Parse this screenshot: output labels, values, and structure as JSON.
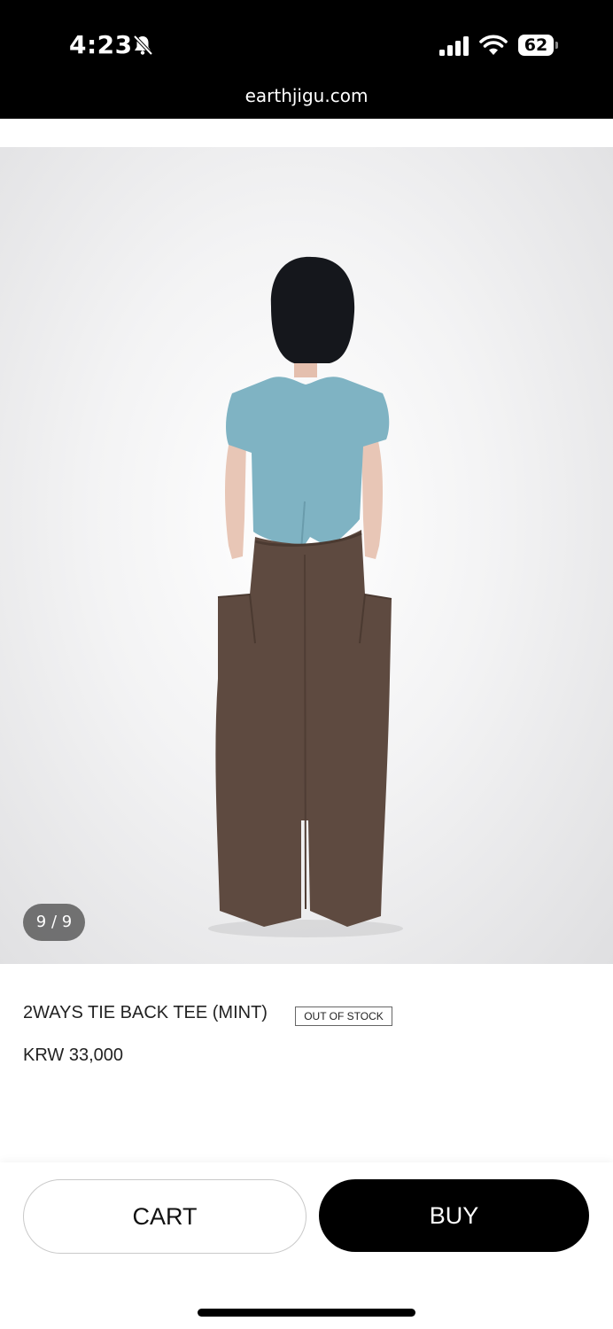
{
  "status_bar": {
    "time": "4:23",
    "battery": "62",
    "icons": [
      "bell-slash-icon",
      "cellular-signal-icon",
      "wifi-icon",
      "battery-icon"
    ]
  },
  "browser": {
    "url": "earthjigu.com"
  },
  "gallery": {
    "counter": "9 / 9"
  },
  "product": {
    "name": "2WAYS TIE BACK TEE (MINT)",
    "stock_badge": "OUT OF STOCK",
    "price": "KRW 33,000"
  },
  "actions": {
    "cart_label": "CART",
    "buy_label": "BUY"
  },
  "colors": {
    "top": "#7fb3c3",
    "pants": "#5e4a40",
    "background": "#ececed"
  }
}
